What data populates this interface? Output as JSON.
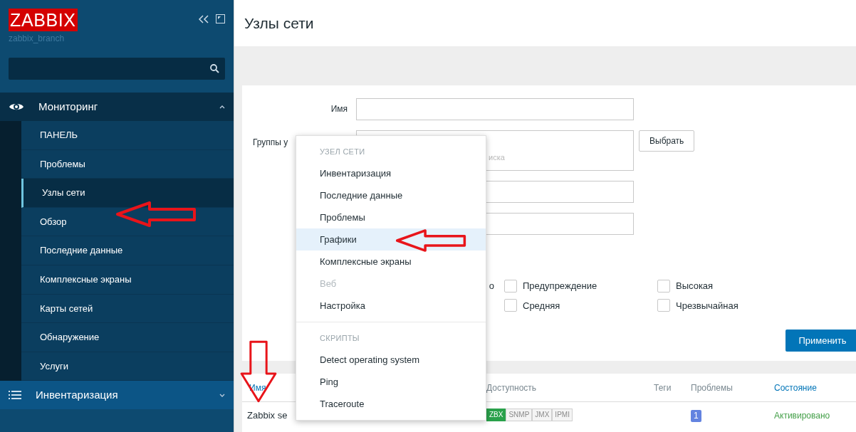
{
  "sidebar": {
    "logo": "ZABBIX",
    "server_name": "zabbix_branch",
    "menu": [
      {
        "label": "Мониторинг",
        "expanded": true,
        "children": [
          {
            "label": "ПАНЕЛЬ",
            "selected": false
          },
          {
            "label": "Проблемы",
            "selected": false
          },
          {
            "label": "Узлы сети",
            "selected": true
          },
          {
            "label": "Обзор",
            "selected": false
          },
          {
            "label": "Последние данные",
            "selected": false
          },
          {
            "label": "Комплексные экраны",
            "selected": false
          },
          {
            "label": "Карты сетей",
            "selected": false
          },
          {
            "label": "Обнаружение",
            "selected": false
          },
          {
            "label": "Услуги",
            "selected": false
          }
        ]
      },
      {
        "label": "Инвентаризация",
        "expanded": false
      }
    ]
  },
  "page": {
    "title": "Узлы сети"
  },
  "filter": {
    "fields": [
      {
        "kind": "text",
        "label": "Имя"
      },
      {
        "kind": "multiselect",
        "label": "Группы у",
        "placeholder": "иска",
        "button": "Выбрать"
      },
      {
        "kind": "text"
      },
      {
        "kind": "text"
      }
    ],
    "severity_fragment": "о",
    "severities": [
      {
        "label": "Предупреждение",
        "checked": false
      },
      {
        "label": "Высокая",
        "checked": false
      },
      {
        "label": "Средняя",
        "checked": false
      },
      {
        "label": "Чрезвычайная",
        "checked": false
      }
    ],
    "apply_button": "Применить"
  },
  "table": {
    "columns": [
      {
        "label": "Имя",
        "sortable": true
      },
      {
        "label": "Доступность",
        "sortable": false
      },
      {
        "label": "Теги",
        "sortable": false
      },
      {
        "label": "Проблемы",
        "sortable": false
      },
      {
        "label": "Состояние",
        "sortable": true
      }
    ],
    "rows": [
      {
        "name": "Zabbix se",
        "availability": [
          {
            "label": "ZBX",
            "on": true
          },
          {
            "label": "SNMP",
            "on": false
          },
          {
            "label": "JMX",
            "on": false
          },
          {
            "label": "IPMI",
            "on": false
          }
        ],
        "problems": "1",
        "status": "Активировано"
      }
    ]
  },
  "context_menu": {
    "sections": [
      {
        "title": "УЗЕЛ СЕТИ",
        "items": [
          {
            "label": "Инвентаризация",
            "selected": false,
            "disabled": false
          },
          {
            "label": "Последние данные",
            "selected": false,
            "disabled": false
          },
          {
            "label": "Проблемы",
            "selected": false,
            "disabled": false
          },
          {
            "label": "Графики",
            "selected": true,
            "disabled": false
          },
          {
            "label": "Комплексные экраны",
            "selected": false,
            "disabled": false
          },
          {
            "label": "Веб",
            "selected": false,
            "disabled": true
          },
          {
            "label": "Настройка",
            "selected": false,
            "disabled": false
          }
        ]
      },
      {
        "title": "СКРИПТЫ",
        "items": [
          {
            "label": "Detect operating system",
            "selected": false,
            "disabled": false
          },
          {
            "label": "Ping",
            "selected": false,
            "disabled": false
          },
          {
            "label": "Traceroute",
            "selected": false,
            "disabled": false
          }
        ]
      }
    ]
  },
  "annotations": [
    {
      "kind": "left_arrow"
    },
    {
      "kind": "left_arrow"
    },
    {
      "kind": "down_arrow"
    }
  ]
}
